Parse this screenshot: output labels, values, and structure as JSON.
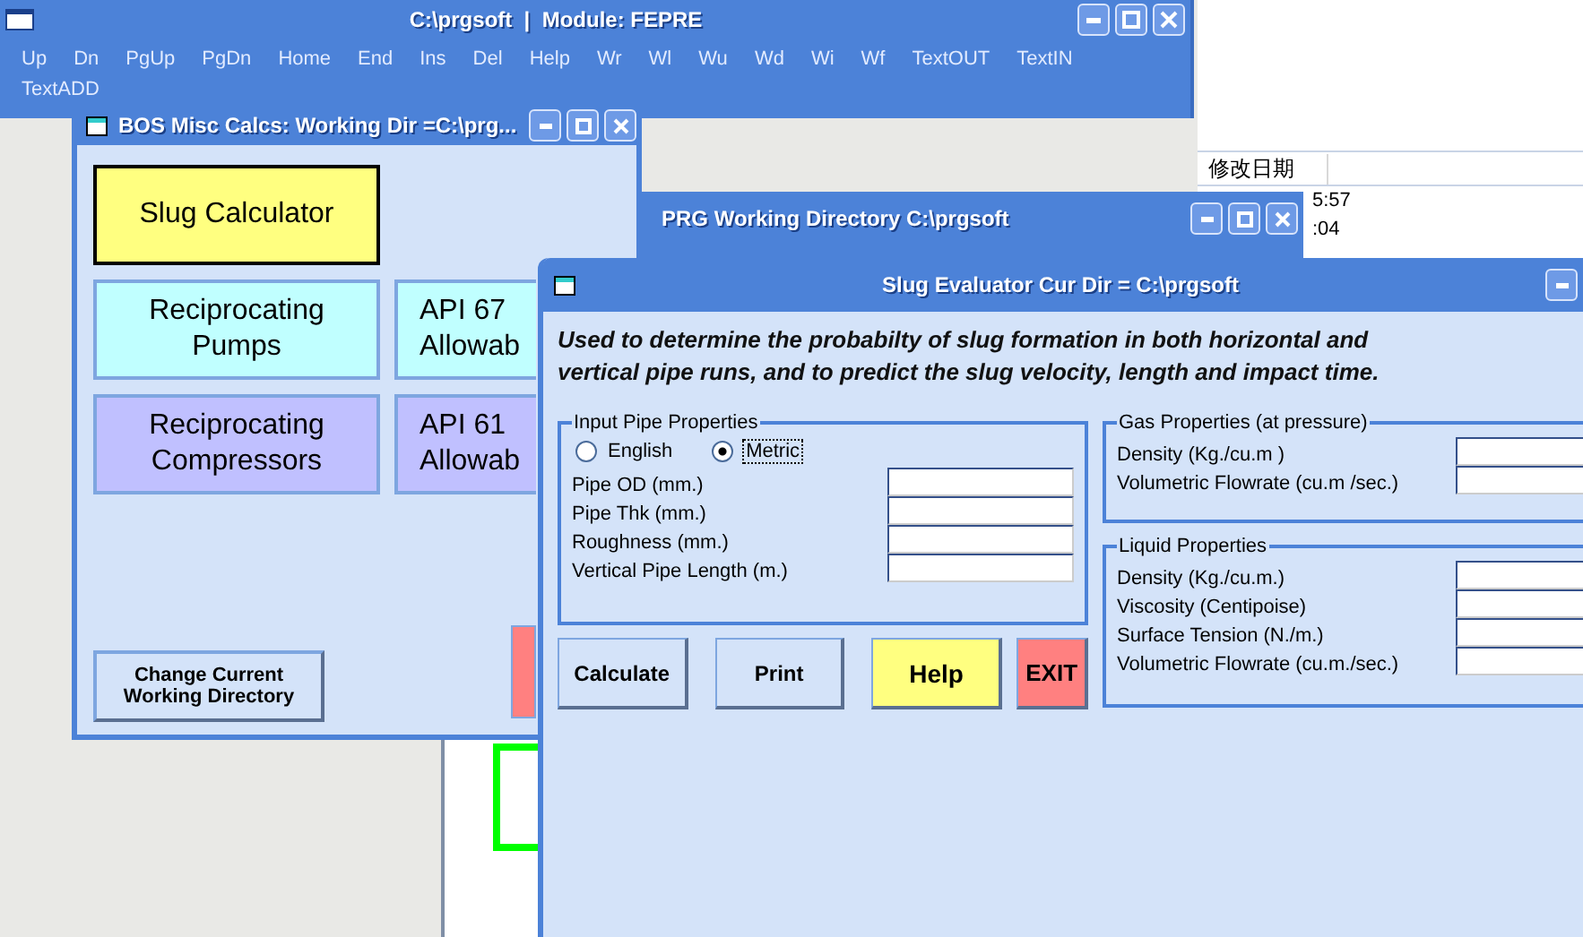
{
  "main_window": {
    "title": "C:\\prgsoft  |  Module: FEPRE",
    "menu": [
      "Up",
      "Dn",
      "PgUp",
      "PgDn",
      "Home",
      "End",
      "Ins",
      "Del",
      "Help",
      "Wr",
      "Wl",
      "Wu",
      "Wd",
      "Wi",
      "Wf",
      "TextOUT",
      "TextIN",
      "TextADD"
    ]
  },
  "explorer_window": {
    "column_header": "修改日期",
    "rows": [
      "5:57",
      ":04"
    ]
  },
  "bos_window": {
    "title": "BOS Misc Calcs: Working Dir =C:\\prg...",
    "buttons": [
      {
        "label": "Slug Calculator",
        "color": "#ffff80"
      },
      {
        "label": "Reciprocating\nPumps",
        "color": "#c0ffff"
      },
      {
        "label": "API 67\nAllowab",
        "color": "#c0ffff"
      },
      {
        "label": "Reciprocating\nCompressors",
        "color": "#c0c0ff"
      },
      {
        "label": "API 61\nAllowab",
        "color": "#c0c0ff"
      }
    ],
    "change_dir_button": "Change Current\nWorking Directory"
  },
  "prg_window": {
    "title": "PRG Working Directory C:\\prgsoft"
  },
  "slug_window": {
    "title": "Slug Evaluator Cur Dir = C:\\prgsoft",
    "description": "Used to determine the probabilty of slug formation in both horizontal and vertical pipe runs, and to predict the slug velocity, length and impact time.",
    "pipe_group": {
      "title": "Input Pipe Properties",
      "units": [
        {
          "label": "English",
          "selected": false
        },
        {
          "label": "Metric",
          "selected": true
        }
      ],
      "fields": [
        "Pipe OD (mm.)",
        "Pipe Thk (mm.)",
        "Roughness (mm.)",
        "Vertical Pipe Length (m.)"
      ]
    },
    "gas_group": {
      "title": "Gas Properties (at pressure)",
      "fields": [
        "Density (Kg./cu.m )",
        "Volumetric Flowrate (cu.m /sec.)"
      ]
    },
    "liquid_group": {
      "title": "Liquid Properties",
      "fields": [
        "Density (Kg./cu.m.)",
        "Viscosity (Centipoise)",
        "Surface Tension (N./m.)",
        "Volumetric Flowrate (cu.m./sec.)"
      ]
    },
    "buttons": [
      {
        "label": "Calculate",
        "kind": "plain"
      },
      {
        "label": "Print",
        "kind": "plain"
      },
      {
        "label": "Help",
        "kind": "help"
      },
      {
        "label": "EXIT",
        "kind": "exit"
      }
    ]
  }
}
